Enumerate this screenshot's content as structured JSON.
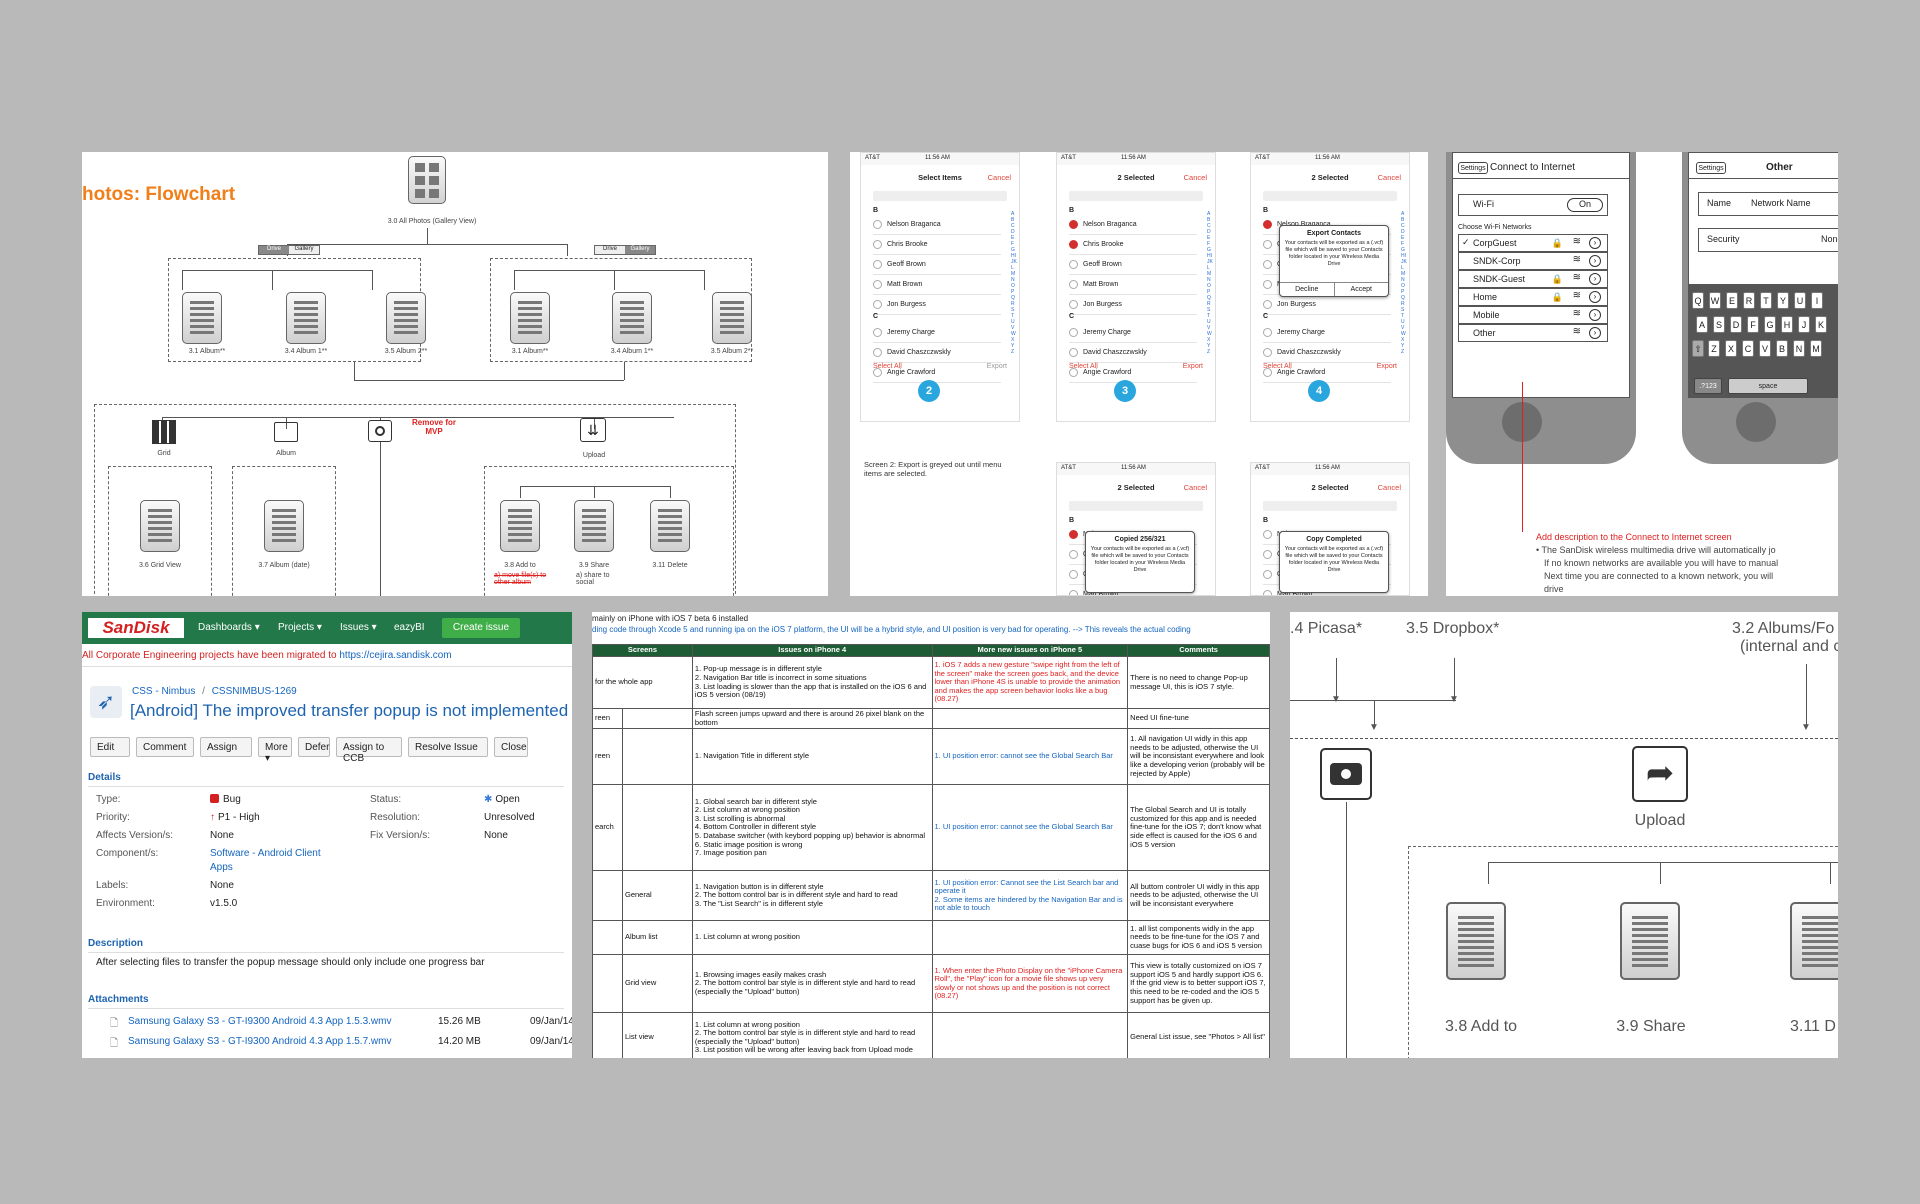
{
  "flowchart": {
    "title": "hotos: Flowchart",
    "root_label": "3.0 All Photos (Gallery View)",
    "toggle_left": [
      "Drive",
      "Gallery"
    ],
    "toggle_right": [
      "Drive",
      "Gallery"
    ],
    "albums_left": [
      "3.1 Album**",
      "3.4 Album 1**",
      "3.5 Album 2**"
    ],
    "albums_right": [
      "3.1 Album**",
      "3.4 Album 1**",
      "3.5 Album 2**"
    ],
    "grid_label": "Grid",
    "album_label": "Album",
    "remove_note": "Remove for MVP",
    "upload_label": "Upload",
    "grid_view": "3.6 Grid View",
    "album_date": "3.7 Album (date)",
    "add_to": "3.8 Add to",
    "add_to_note": "a) move file(s) to other album",
    "share": "3.9 Share",
    "share_note": "a) share to social",
    "delete": "3.11 Delete"
  },
  "contacts": {
    "status_carrier": "AT&T",
    "status_time": "11:56 AM",
    "screen2": {
      "title": "Select Items",
      "cancel": "Cancel",
      "select_all": "Select All",
      "export": "Export",
      "step": "2"
    },
    "screen3": {
      "title": "2 Selected",
      "cancel": "Cancel",
      "select_all": "Select All",
      "export": "Export",
      "step": "3"
    },
    "screen4": {
      "title": "2 Selected",
      "cancel": "Cancel",
      "select_all": "Select All",
      "export": "Export",
      "step": "4"
    },
    "section_b": "B",
    "section_c": "C",
    "names": [
      "Nelson Braganca",
      "Chris Brooke",
      "Geoff Brown",
      "Matt Brown",
      "Jon Burgess",
      "Jeremy Charge",
      "David Chaszczwskly",
      "Angie Crawford"
    ],
    "note": "Screen 2: Export is greyed out until menu items are selected.",
    "dialog": {
      "title": "Export Contacts",
      "body": "Your contacts will be exported as a (.vcf) file which will be saved to your Contacts folder located in your Wireless Media Drive",
      "decline": "Decline",
      "accept": "Accept"
    },
    "copied": {
      "title": "Copied 256/321",
      "body": "Your contacts will be exported as a (.vcf) file which will be saved to your Contacts folder located in your Wireless Media Drive"
    },
    "completed": {
      "title": "Copy Completed",
      "body": "Your contacts will be exported as a (.vcf) file which will be saved to your Contacts folder located in your Wireless Media Drive"
    },
    "index_letters": "ABCDEFGHIJKLMNOPQRSTUVWXYZ"
  },
  "wifi": {
    "settings_btn": "Settings",
    "title": "Connect to Internet",
    "wifi_label": "Wi-Fi",
    "toggle": "On",
    "choose": "Choose Wi-Fi Networks",
    "networks": [
      "CorpGuest",
      "SNDK-Corp",
      "SNDK-Guest",
      "Home",
      "Mobile",
      "Other"
    ],
    "other_title": "Other",
    "name_label": "Name",
    "name_value": "Network Name",
    "security_label": "Security",
    "security_value": "None",
    "keys_row1": [
      "Q",
      "W",
      "E",
      "R",
      "T",
      "Y",
      "U",
      "I"
    ],
    "keys_row2": [
      "A",
      "S",
      "D",
      "F",
      "G",
      "H",
      "J",
      "K"
    ],
    "keys_row3": [
      "Z",
      "X",
      "C",
      "V",
      "B",
      "N",
      "M"
    ],
    "key_123": ".?123",
    "key_space": "space",
    "desc_title": "Add description to the Connect to Internet screen",
    "desc_lines": [
      "• The SanDisk wireless multimedia drive will automatically jo",
      "If no known networks are available you will have to manual",
      "Next time you are connected to a known network, you will",
      "drive"
    ]
  },
  "jira": {
    "logo": "SanDisk",
    "nav": [
      "Dashboards ▾",
      "Projects ▾",
      "Issues ▾",
      "eazyBI"
    ],
    "create": "Create issue",
    "banner_text": "All Corporate Engineering projects have been migrated to ",
    "banner_link": "https://cejira.sandisk.com",
    "crumb_project": "CSS - Nimbus",
    "crumb_sep": "/",
    "crumb_issue": "CSSNIMBUS-1269",
    "issue_title": "[Android] The improved transfer popup is not implemented",
    "buttons": [
      "Edit",
      "Comment",
      "Assign",
      "More ▾",
      "Defer",
      "Assign to CCB",
      "Resolve Issue",
      "Close"
    ],
    "details_h": "Details",
    "type_k": "Type:",
    "type_v": "Bug",
    "priority_k": "Priority:",
    "priority_v": "P1 - High",
    "affects_k": "Affects Version/s:",
    "affects_v": "None",
    "component_k": "Component/s:",
    "component_v1": "Software - Android Client",
    "component_v2": "Apps",
    "labels_k": "Labels:",
    "labels_v": "None",
    "env_k": "Environment:",
    "env_v": "v1.5.0",
    "status_k": "Status:",
    "status_v": "Open",
    "resolution_k": "Resolution:",
    "resolution_v": "Unresolved",
    "fix_k": "Fix Version/s:",
    "fix_v": "None",
    "desc_h": "Description",
    "desc": "After selecting files to transfer the popup message should only include one progress bar",
    "attach_h": "Attachments",
    "attachments": [
      {
        "name": "Samsung Galaxy S3 - GT-I9300 Android 4.3 App 1.5.3.wmv",
        "size": "15.26 MB",
        "date": "09/Jan/14"
      },
      {
        "name": "Samsung Galaxy S3 - GT-I9300 Android 4.3 App 1.5.7.wmv",
        "size": "14.20 MB",
        "date": "09/Jan/14"
      }
    ]
  },
  "sheet": {
    "line1": "mainly on iPhone with iOS 7 beta 6 installed",
    "line2": "ding code through Xcode 5 and running ipa on the iOS 7 platform, the UI will be a hybrid style, and UI position is very bad for operating. --> This reveals the actual coding",
    "headers": [
      "Screens",
      "Issues on iPhone 4",
      "More new issues on iPhone 5",
      "Comments"
    ],
    "r1": {
      "a": "for the whole app",
      "b": "",
      "i4": "1. Pop-up message is in different style\n2. Navigation Bar title is incorrect in some situations\n3. List loading is slower than the app that is installed on the iOS 6 and iOS 5 version (08/19)",
      "i5": "1. iOS 7 adds a new gesture \"swipe right from the left of the screen\" make the screen goes back, and the device lower than iPhone 4S is unable to provide the animation and makes the app screen behavior looks like a bug (08.27)",
      "c": "There is no need to change Pop-up message UI, this is iOS 7 style."
    },
    "r2": {
      "a": "reen",
      "b": "",
      "i4": "Flash screen jumps upward and there is around 26 pixel blank on the bottom",
      "i5": "",
      "c": "Need UI fine-tune"
    },
    "r3": {
      "a": "reen",
      "b": "",
      "i4": "1. Navigation Title in different style",
      "i5": "1. UI position error: cannot see the Global Search Bar",
      "c": "1. All navigation UI widly in this app needs to be adjusted, otherwise the UI will be inconsistant everywhere and look like a developing verion (probably will be rejected by Apple)"
    },
    "r4": {
      "a": "earch",
      "b": "",
      "i4": "1. Global search bar in different style\n2. List column at wrong position\n3. List scrolling is abnormal\n4. Bottom Controller in different style\n5. Database switcher (with keybord popping up) behavior is abnormal\n6. Static image position is wrong\n7. Image position pan",
      "i5": "1. UI position error: cannot see the Global Search Bar",
      "c": "The Global Search and UI is totally customized for this app and is needed fine-tune for the iOS 7; don't know what side effect is caused for the iOS 6 and iOS 5 version"
    },
    "r5": {
      "a": "",
      "b": "General",
      "i4": "1. Navigation button is in different style\n2. The bottom control bar is in different style and hard to read\n3. The \"List Search\" is in different style",
      "i5": "1. UI position error: Cannot see the List Search bar and operate it\n2. Some items are hindered by the Navigation Bar and is not able to touch",
      "c": "All buttom controler UI widly in this app needs to be adjusted, otherwise the UI will be inconsistant everywhere"
    },
    "r6": {
      "a": "",
      "b": "Album list",
      "i4": "1. List column at wrong position",
      "i5": "",
      "c": "1. all list components widly in the app needs to be fine-tune for the iOS 7 and cuase bugs for iOS 6 and iOS 5 version"
    },
    "r7": {
      "a": "",
      "b": "Grid view",
      "i4": "1. Browsing images easily makes crash\n2. The bottom control bar style is in different style and hard to read (especially the \"Upload\" button)",
      "i5": "1. When enter the Photo Display on the \"iPhone Camera Roll\", the \"Play\" icon for a movie file shows up very slowly or not shows up and the position is not correct (08.27)",
      "c": "This view is totally customized on iOS 7 support iOS 5 and hardly support iOS 6. If the grid view is to better support iOS 7, this need to be re-coded and the iOS 5 support has be given up."
    },
    "r8": {
      "a": "",
      "b": "List view",
      "i4": "1. List column at wrong position\n2. The bottom control bar style is in different style and hard to read (especially the \"Upload\" button)\n3. List position will be wrong after leaving back from Upload mode",
      "i5": "",
      "c": "General List issue, see \"Photos > All list\""
    }
  },
  "zoom": {
    "picasa": ".4 Picasa*",
    "dropbox": "3.5 Dropbox*",
    "albums": "3.2 Albums/Fo",
    "albums_sub": "(internal and c",
    "upload": "Upload",
    "add_to": "3.8 Add to",
    "share": "3.9 Share",
    "delete": "3.11 D"
  }
}
